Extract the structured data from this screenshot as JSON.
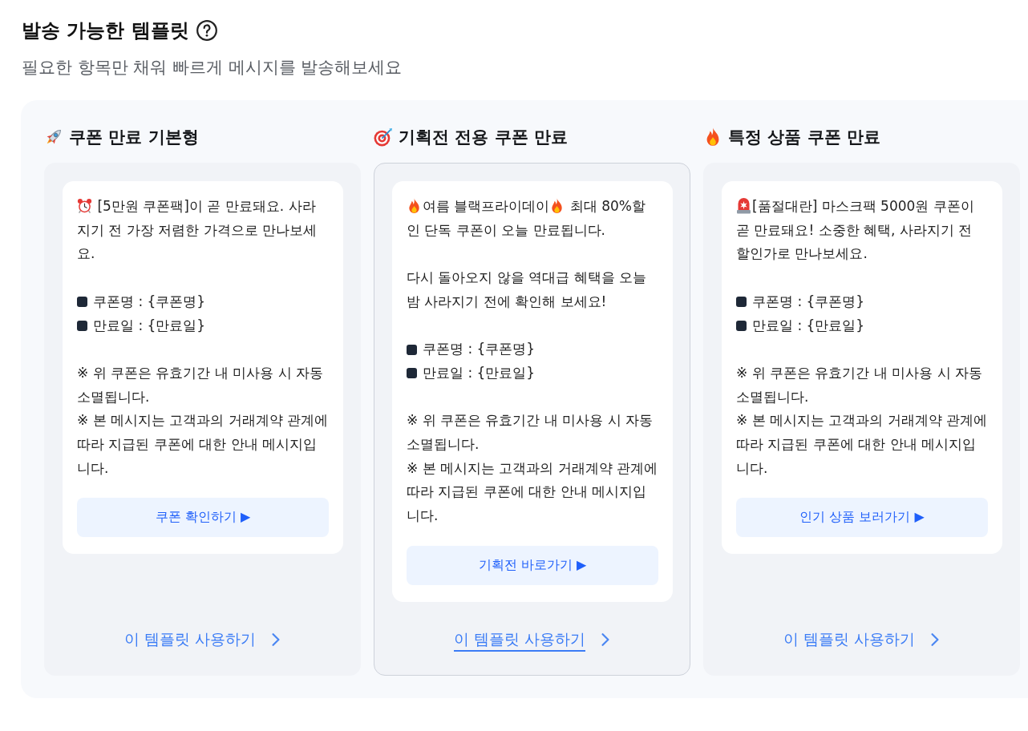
{
  "header": {
    "title": "발송 가능한 템플릿",
    "subtitle": "필요한 항목만 채워 빠르게 메시지를 발송해보세요"
  },
  "templates": [
    {
      "title": "쿠폰 만료 기본형",
      "selected": false,
      "message": [
        {
          "kind": "paragraph",
          "parts": [
            {
              "kind": "emoji"
            },
            {
              "kind": "text",
              "text": " [5만원 쿠폰팩]이 곧 만료돼요. 사라지기 전 가장 저렴한 가격으로 만나보세요."
            }
          ]
        },
        {
          "kind": "bullets",
          "lines": [
            "쿠폰명 : {쿠폰명}",
            "만료일 : {만료일}"
          ]
        },
        {
          "kind": "notes",
          "lines": [
            "※ 위 쿠폰은 유효기간 내 미사용 시 자동 소멸됩니다.",
            "※ 본 메시지는 고객과의 거래계약 관계에 따라 지급된 쿠폰에 대한 안내 메시지입니다."
          ]
        }
      ],
      "button": "쿠폰 확인하기 ▶",
      "action": "이 템플릿 사용하기"
    },
    {
      "title": "기획전 전용 쿠폰 만료",
      "selected": true,
      "message": [
        {
          "kind": "paragraph",
          "parts": [
            {
              "kind": "emoji"
            },
            {
              "kind": "text",
              "text": "여름 블랙프라이데이"
            },
            {
              "kind": "emoji"
            },
            {
              "kind": "text",
              "text": " 최대 80%할인 단독 쿠폰이 오늘 만료됩니다."
            }
          ]
        },
        {
          "kind": "paragraph",
          "parts": [
            {
              "kind": "text",
              "text": "다시 돌아오지 않을 역대급 혜택을 오늘 밤 사라지기 전에 확인해 보세요!"
            }
          ]
        },
        {
          "kind": "bullets",
          "lines": [
            "쿠폰명 : {쿠폰명}",
            "만료일 : {만료일}"
          ]
        },
        {
          "kind": "notes",
          "lines": [
            "※ 위 쿠폰은 유효기간 내 미사용 시 자동 소멸됩니다.",
            "※ 본 메시지는 고객과의 거래계약 관계에 따라 지급된 쿠폰에 대한 안내 메시지입니다."
          ]
        }
      ],
      "button": "기획전 바로가기 ▶",
      "action": "이 템플릿 사용하기"
    },
    {
      "title": "특정 상품 쿠폰 만료",
      "selected": false,
      "message": [
        {
          "kind": "paragraph",
          "parts": [
            {
              "kind": "emoji"
            },
            {
              "kind": "text",
              "text": "[품절대란] 마스크팩 5000원 쿠폰이 곧 만료돼요! 소중한 혜택, 사라지기 전 할인가로 만나보세요."
            }
          ]
        },
        {
          "kind": "bullets",
          "lines": [
            "쿠폰명 : {쿠폰명}",
            "만료일 : {만료일}"
          ]
        },
        {
          "kind": "notes",
          "lines": [
            "※ 위 쿠폰은 유효기간 내 미사용 시 자동 소멸됩니다.",
            "※ 본 메시지는 고객과의 거래계약 관계에 따라 지급된 쿠폰에 대한 안내 메시지입니다."
          ]
        }
      ],
      "button": "인기 상품 보러가기 ▶",
      "action": "이 템플릿 사용하기"
    }
  ]
}
